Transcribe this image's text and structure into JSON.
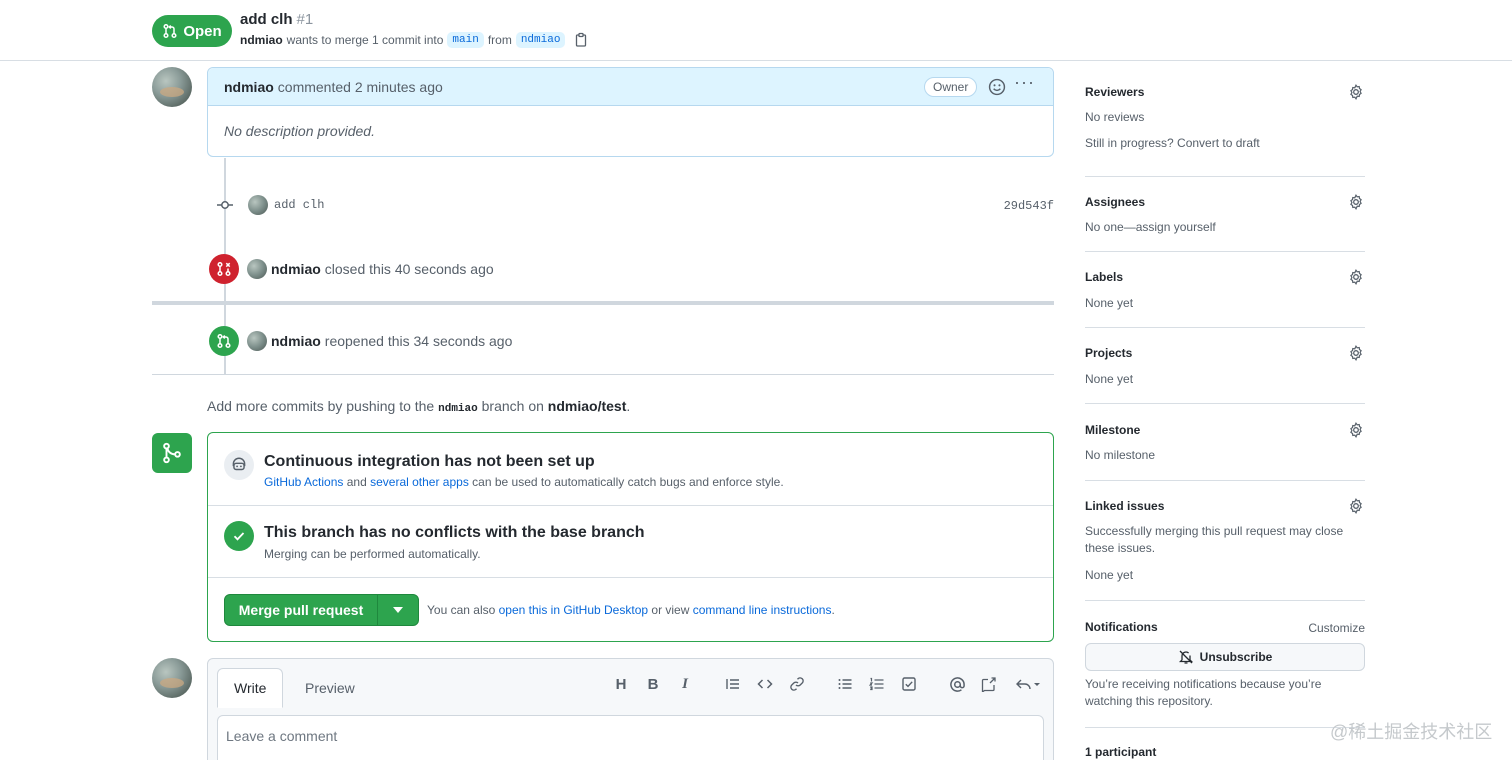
{
  "header": {
    "state": "Open",
    "title": "add clh",
    "number": "#1",
    "author": "ndmiao",
    "meta_text": "wants to merge 1 commit into",
    "base_branch": "main",
    "from_text": "from",
    "head_branch": "ndmiao"
  },
  "comment": {
    "author": "ndmiao",
    "action": "commented 2 minutes ago",
    "badge": "Owner",
    "more": "···",
    "body": "No description provided."
  },
  "commit": {
    "message": "add clh",
    "sha": "29d543f"
  },
  "events": {
    "closed": {
      "actor": "ndmiao",
      "text": "closed this 40 seconds ago"
    },
    "reopened": {
      "actor": "ndmiao",
      "text": "reopened this 34 seconds ago"
    }
  },
  "push_note": {
    "prefix": "Add more commits by pushing to the",
    "branch": "ndmiao",
    "middle": "branch on",
    "repo": "ndmiao/test",
    "suffix": "."
  },
  "merge": {
    "ci_title": "Continuous integration has not been set up",
    "ci_link1": "GitHub Actions",
    "ci_and": "and",
    "ci_link2": "several other apps",
    "ci_rest": "can be used to automatically catch bugs and enforce style.",
    "conflict_title": "This branch has no conflicts with the base branch",
    "conflict_sub": "Merging can be performed automatically.",
    "button": "Merge pull request",
    "hint_prefix": "You can also",
    "hint_link1": "open this in GitHub Desktop",
    "hint_mid": "or view",
    "hint_link2": "command line instructions",
    "hint_suffix": "."
  },
  "composer": {
    "tab_write": "Write",
    "tab_preview": "Preview",
    "placeholder": "Leave a comment",
    "toolbar": {
      "heading": "H",
      "bold": "B",
      "italic": "I"
    }
  },
  "sidebar": {
    "reviewers": {
      "title": "Reviewers",
      "value": "No reviews",
      "extra": "Still in progress? Convert to draft"
    },
    "assignees": {
      "title": "Assignees",
      "value": "No one—assign yourself"
    },
    "labels": {
      "title": "Labels",
      "value": "None yet"
    },
    "projects": {
      "title": "Projects",
      "value": "None yet"
    },
    "milestone": {
      "title": "Milestone",
      "value": "No milestone"
    },
    "linked_issues": {
      "title": "Linked issues",
      "desc": "Successfully merging this pull request may close these issues.",
      "value": "None yet"
    },
    "notifications": {
      "title": "Notifications",
      "customize": "Customize",
      "button": "Unsubscribe",
      "desc": "You’re receiving notifications because you’re watching this repository."
    },
    "participants": {
      "title": "1 participant"
    }
  },
  "watermark": "@稀土掘金技术社区",
  "colors": {
    "open": "#2da44e",
    "closed": "#cf222e",
    "link": "#0969da"
  }
}
